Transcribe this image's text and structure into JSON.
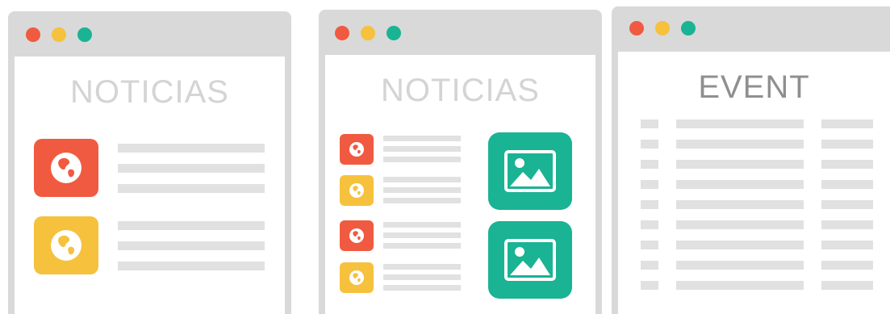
{
  "colors": {
    "window_frame": "#d9d9d9",
    "dot_red": "#f05a40",
    "dot_yellow": "#f6c13c",
    "dot_green": "#1ab394",
    "icon_red": "#f05a40",
    "icon_yellow": "#f6c13c",
    "image_green": "#1ab394",
    "line_gray": "#e1e1e1",
    "heading_light": "#d4d4d4",
    "heading_dark": "#8f8f8f"
  },
  "windows": [
    {
      "heading": "NOTICIAS",
      "icons": [
        "globe-icon",
        "globe-icon"
      ]
    },
    {
      "heading": "NOTICIAS",
      "icons": [
        "globe-icon",
        "globe-icon",
        "globe-icon",
        "globe-icon",
        "image-icon",
        "image-icon"
      ]
    },
    {
      "heading": "EVENT"
    }
  ]
}
